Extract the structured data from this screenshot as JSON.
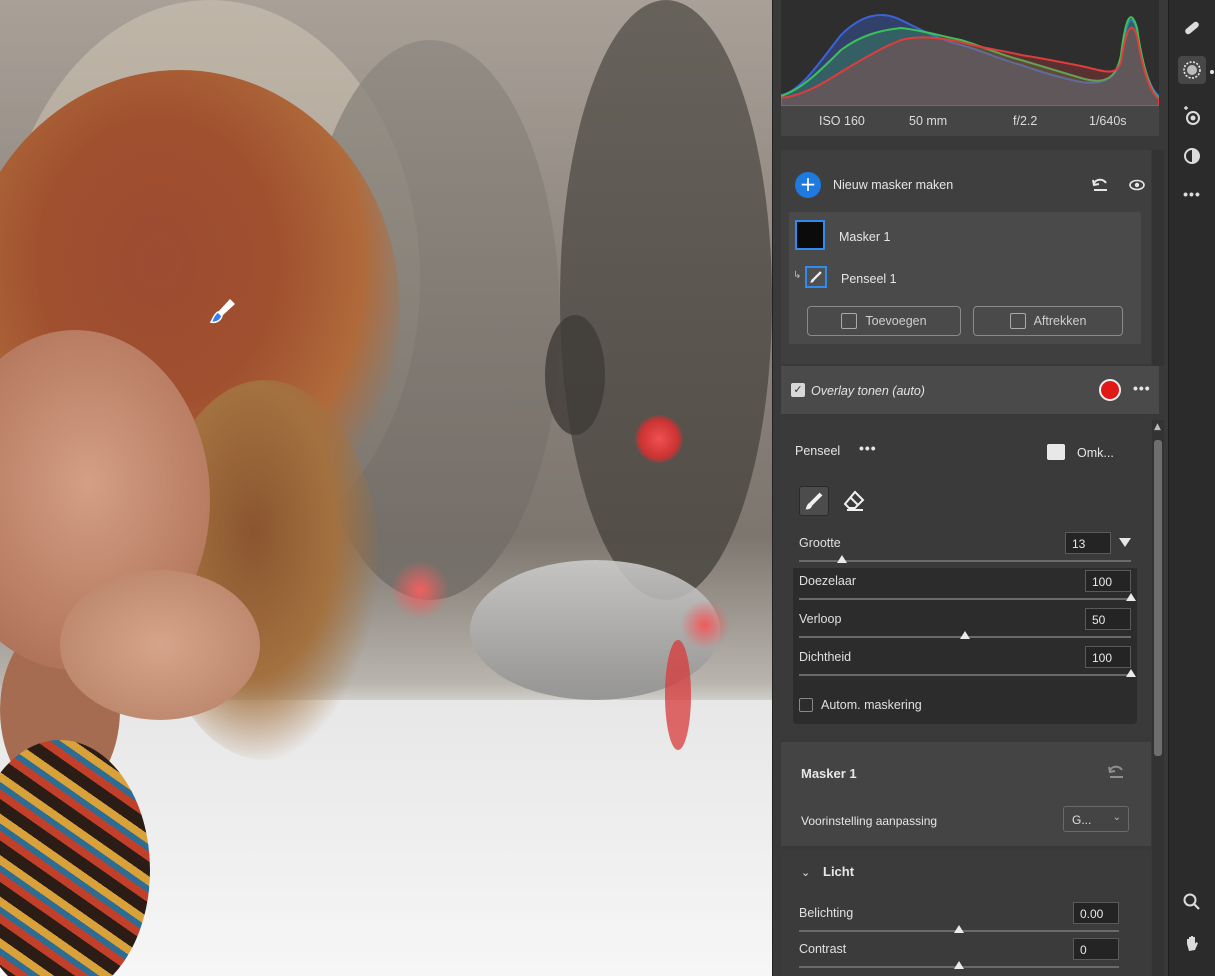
{
  "exif": {
    "iso": "ISO 160",
    "focal": "50 mm",
    "aperture": "f/2.2",
    "shutter": "1/640s"
  },
  "masks": {
    "new_mask_label": "Nieuw masker maken",
    "mask1_label": "Masker 1",
    "brush1_label": "Penseel 1",
    "add_label": "Toevoegen",
    "subtract_label": "Aftrekken"
  },
  "overlay": {
    "label": "Overlay tonen (auto)",
    "checked": true,
    "color": "#e11818"
  },
  "brush": {
    "title": "Penseel",
    "invert_label": "Omk...",
    "sliders": [
      {
        "label": "Grootte",
        "value": "13",
        "position": 0.13
      },
      {
        "label": "Doezelaar",
        "value": "100",
        "position": 1.0
      },
      {
        "label": "Verloop",
        "value": "50",
        "position": 0.5
      },
      {
        "label": "Dichtheid",
        "value": "100",
        "position": 1.0
      }
    ],
    "auto_mask_label": "Autom. maskering",
    "auto_mask_checked": false
  },
  "mask_panel": {
    "title": "Masker 1",
    "preset_label": "Voorinstelling aanpassing",
    "preset_value": "G..."
  },
  "licht": {
    "title": "Licht",
    "sliders": [
      {
        "label": "Belichting",
        "value": "0.00",
        "position": 0.5
      },
      {
        "label": "Contrast",
        "value": "0",
        "position": 0.5
      }
    ]
  },
  "toolbar": {
    "icons": [
      "heal-icon",
      "masking-icon",
      "red-eye-icon",
      "presets-icon",
      "more-icon",
      "zoom-icon",
      "hand-icon"
    ]
  },
  "colors": {
    "accent": "#1f7ae0",
    "panel": "#393939",
    "histogram_red": "#e03c3c",
    "histogram_green": "#3cc15a",
    "histogram_blue": "#3a63d8"
  }
}
